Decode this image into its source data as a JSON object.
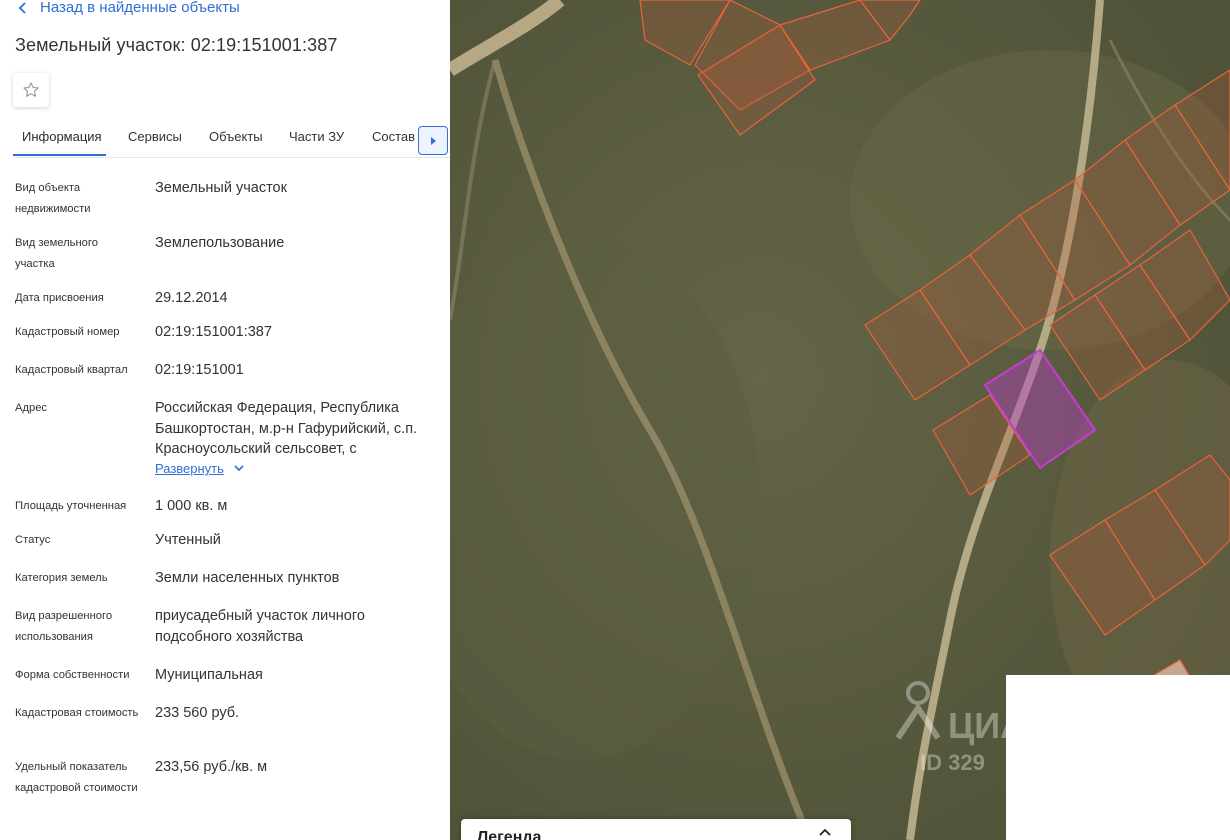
{
  "header": {
    "back_label": "Назад в найденные объекты",
    "title": "Земельный участок: 02:19:151001:387"
  },
  "tabs": [
    {
      "label": "Информация"
    },
    {
      "label": "Сервисы"
    },
    {
      "label": "Объекты"
    },
    {
      "label": "Части ЗУ"
    },
    {
      "label": "Состав"
    }
  ],
  "info": {
    "object_type": {
      "label": "Вид объекта недвижимости",
      "value": "Земельный участок"
    },
    "land_type": {
      "label": "Вид земельного участка",
      "value": "Землепользование"
    },
    "date": {
      "label": "Дата присвоения",
      "value": "29.12.2014"
    },
    "cad_number": {
      "label": "Кадастровый номер",
      "value": "02:19:151001:387"
    },
    "cad_quarter": {
      "label": "Кадастровый квартал",
      "value": "02:19:151001"
    },
    "address": {
      "label": "Адрес",
      "value": "Российская Федерация, Республика Башкортостан, м.р-н Гафурийский, с.п. Красноусольский сельсовет, с",
      "expand": "Развернуть"
    },
    "area": {
      "label": "Площадь уточненная",
      "value": "1 000 кв. м"
    },
    "status": {
      "label": "Статус",
      "value": "Учтенный"
    },
    "category": {
      "label": "Категория земель",
      "value": "Земли населенных пунктов"
    },
    "permitted_use": {
      "label": "Вид разрешенного использования",
      "value": "приусадебный участок личного подсобного хозяйства"
    },
    "ownership": {
      "label": "Форма собственности",
      "value": "Муниципальная"
    },
    "cad_cost": {
      "label": "Кадастровая стоимость",
      "value": "233 560 руб."
    },
    "specific_cost": {
      "label": "Удельный показатель кадастровой стоимости",
      "value": "233,56 руб./кв. м"
    }
  },
  "map": {
    "legend_title": "Легенда",
    "watermark": "ЦИАН",
    "watermark_id": "ID 329"
  },
  "colors": {
    "accent": "#2f6fd6",
    "parcel_stroke": "#e8633a",
    "selected_parcel": "#c23fd0"
  },
  "icons": {
    "back": "chevron-left-icon",
    "favorite": "star-icon",
    "tabs_scroll": "caret-right-icon",
    "expand": "chevron-down-icon",
    "legend": "chevron-up-icon"
  }
}
